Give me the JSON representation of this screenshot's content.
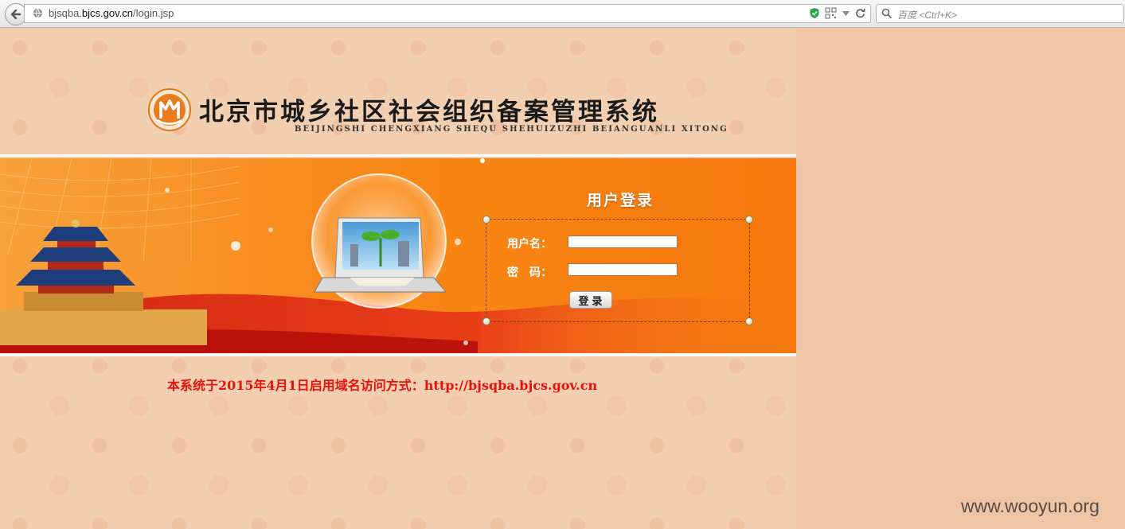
{
  "browser": {
    "url_prefix": "bjsqba.",
    "url_domain": "bjcs.gov.cn",
    "url_path": "/login.jsp",
    "search_placeholder": "百度 <Ctrl+K>"
  },
  "header": {
    "title": "北京市城乡社区社会组织备案管理系统",
    "subtitle": "BEIJINGSHI CHENGXIANG SHEQU SHEHUIZUZHI BEIANGUANLI XITONG"
  },
  "login": {
    "title": "用户登录",
    "username_label": "用户名：",
    "password_label": "密　码：",
    "username_value": "",
    "password_value": "",
    "submit_label": "登录"
  },
  "notice": "本系统于2015年4月1日启用域名访问方式：http://bjsqba.bjcs.gov.cn",
  "watermark": "www.wooyun.org",
  "colors": {
    "banner_orange": "#f88a1c",
    "notice_red": "#e8120c",
    "background": "#efc5a5"
  }
}
